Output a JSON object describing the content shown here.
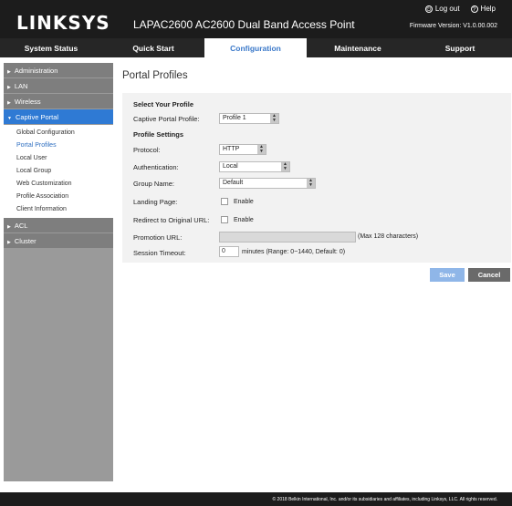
{
  "header": {
    "logo": "LINKSYS",
    "product": "LAPAC2600 AC2600 Dual Band Access Point",
    "logout": "Log out",
    "help": "Help",
    "firmware": "Firmware Version: V1.0.00.002"
  },
  "nav": {
    "tabs": [
      "System Status",
      "Quick Start",
      "Configuration",
      "Maintenance",
      "Support"
    ],
    "active": "Configuration"
  },
  "sidebar": {
    "administration": "Administration",
    "lan": "LAN",
    "wireless": "Wireless",
    "captive_portal": "Captive Portal",
    "sub": [
      "Global Configuration",
      "Portal Profiles",
      "Local User",
      "Local Group",
      "Web Customization",
      "Profile Association",
      "Client Information"
    ],
    "acl": "ACL",
    "cluster": "Cluster"
  },
  "main": {
    "title": "Portal Profiles",
    "select_section": "Select Your Profile",
    "profile_label": "Captive Portal Profile:",
    "profile_value": "Profile 1",
    "settings_section": "Profile Settings",
    "protocol_label": "Protocol:",
    "protocol_value": "HTTP",
    "auth_label": "Authentication:",
    "auth_value": "Local",
    "group_label": "Group Name:",
    "group_value": "Default",
    "landing_label": "Landing Page:",
    "landing_enable": "Enable",
    "redirect_label": "Redirect to Original URL:",
    "redirect_enable": "Enable",
    "promo_label": "Promotion URL:",
    "promo_hint": "(Max 128 characters)",
    "timeout_label": "Session Timeout:",
    "timeout_value": "0",
    "timeout_hint": "minutes (Range: 0~1440, Default: 0)",
    "save": "Save",
    "cancel": "Cancel"
  },
  "footer": {
    "copyright": "© 2018 Belkin International, Inc. and/or its subsidiaries and affiliates, including Linksys, LLC. All rights reserved."
  },
  "colors": {
    "accent": "#2f7ad4",
    "header_bg": "#1c1c1c",
    "save_btn": "#8fb6e8",
    "cancel_btn": "#6a6a6a"
  }
}
